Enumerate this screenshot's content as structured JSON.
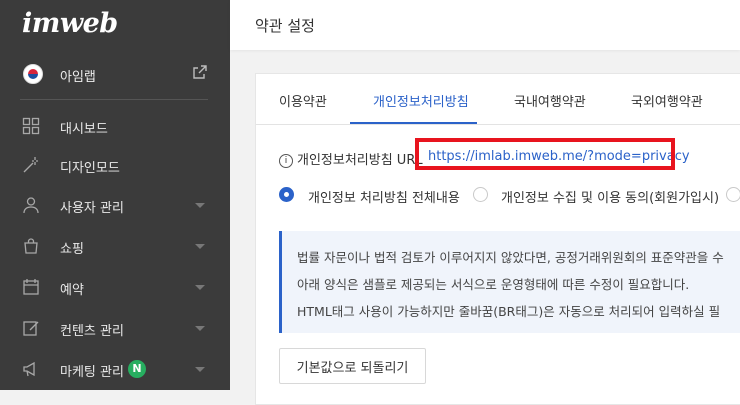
{
  "logo": "imweb",
  "site": {
    "name": "아임랩"
  },
  "sidebar": {
    "items": [
      {
        "label": "대시보드",
        "icon": "dashboard-icon",
        "has_chevron": false
      },
      {
        "label": "디자인모드",
        "icon": "magic-wand-icon",
        "has_chevron": false
      },
      {
        "label": "사용자 관리",
        "icon": "user-icon",
        "has_chevron": true
      },
      {
        "label": "쇼핑",
        "icon": "shopping-bag-icon",
        "has_chevron": true
      },
      {
        "label": "예약",
        "icon": "calendar-icon",
        "has_chevron": true
      },
      {
        "label": "컨텐츠 관리",
        "icon": "edit-icon",
        "has_chevron": true
      },
      {
        "label": "마케팅 관리",
        "icon": "megaphone-icon",
        "has_chevron": true,
        "badge": "N"
      }
    ]
  },
  "header": {
    "title": "약관 설정"
  },
  "tabs": [
    "이용약관",
    "개인정보처리방침",
    "국내여행약관",
    "국외여행약관"
  ],
  "active_tab": 1,
  "privacy_url": {
    "label": "개인정보처리방침 URL",
    "value": "https://imlab.imweb.me/?mode=privacy"
  },
  "radios": [
    {
      "label": "개인정보 처리방침 전체내용",
      "selected": true
    },
    {
      "label": "개인정보 수집 및 이용 동의(회원가입시)",
      "selected": false
    }
  ],
  "notice": {
    "lines": [
      "법률 자문이나 법적 검토가 이루어지지 않았다면, 공정거래위원회의 표준약관을 수",
      "아래 양식은 샘플로 제공되는 서식으로 운영형태에 따른 수정이 필요합니다.",
      "HTML태그 사용이 가능하지만 줄바꿈(BR태그)은 자동으로 처리되어 입력하실 필"
    ]
  },
  "reset_button": "기본값으로 되돌리기",
  "colors": {
    "accent": "#2b62c9",
    "sidebar_bg": "#3b3b3b",
    "highlight": "#e8141e",
    "badge": "#27ae60"
  }
}
